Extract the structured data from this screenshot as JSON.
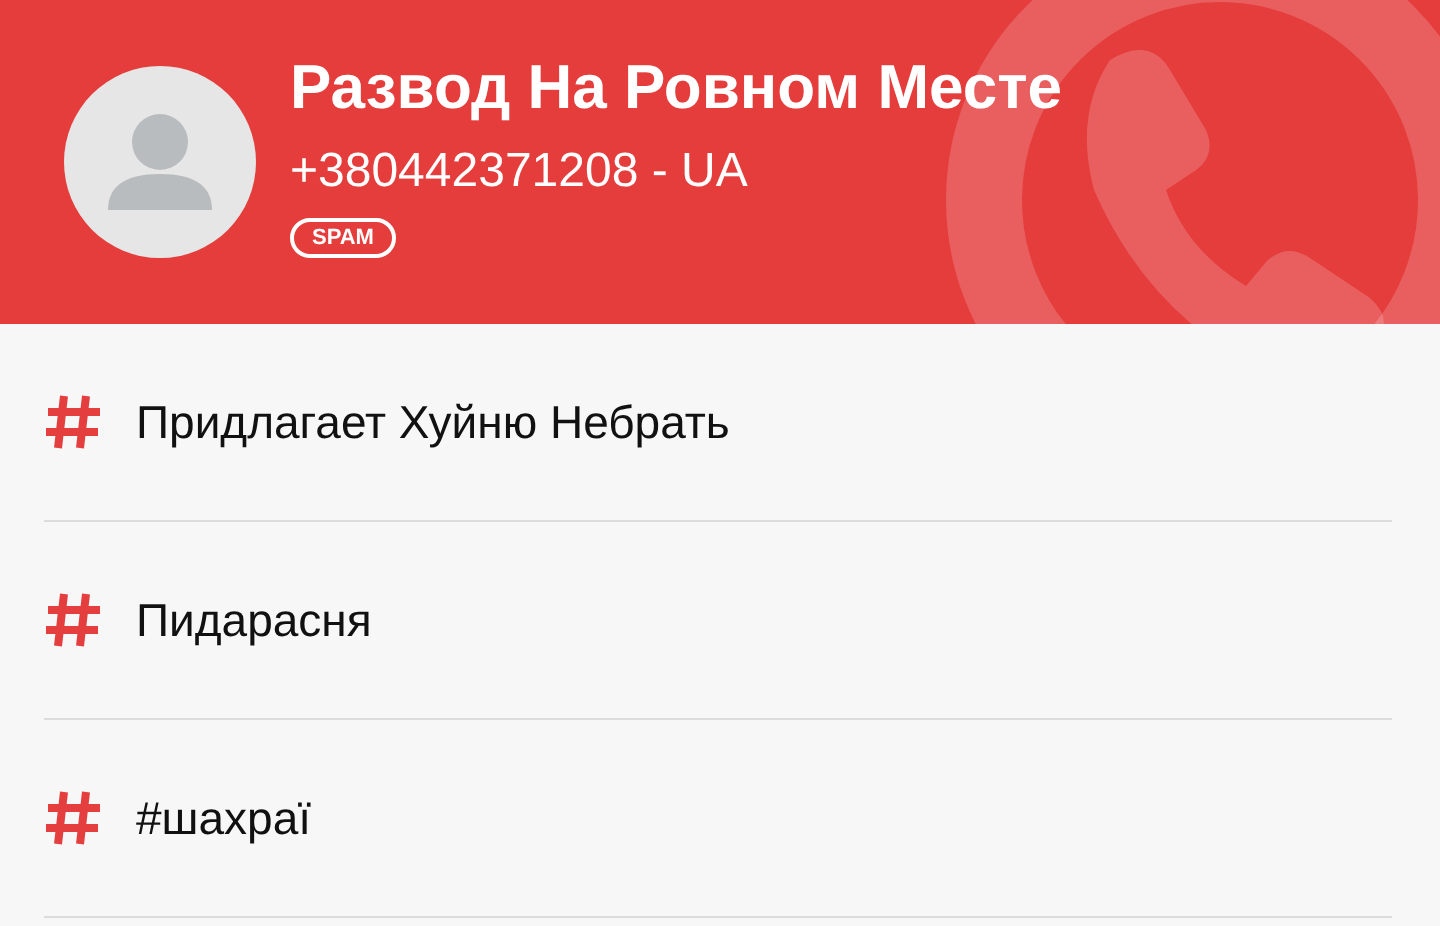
{
  "caller": {
    "name": "Развод На Ровном Месте",
    "phone": "+380442371208 - UA",
    "badge": "SPAM"
  },
  "tags": [
    {
      "label": "Придлагает Хуйню Небрать"
    },
    {
      "label": "Пидарасня"
    },
    {
      "label": "#шахраї"
    }
  ]
}
